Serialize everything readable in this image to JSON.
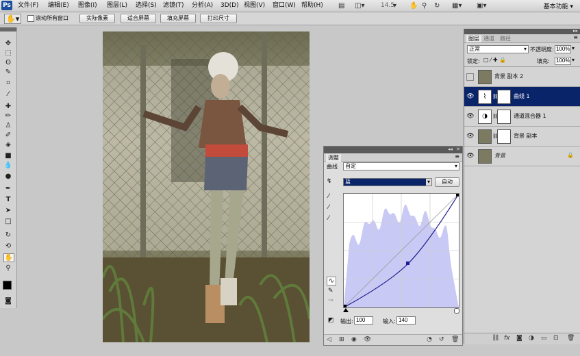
{
  "menu": {
    "logo": "Ps",
    "items": [
      "文件(F)",
      "编辑(E)",
      "图像(I)",
      "图层(L)",
      "选择(S)",
      "滤镜(T)",
      "分析(A)",
      "3D(D)",
      "视图(V)",
      "窗口(W)",
      "帮助(H)"
    ],
    "zoom": "14.5",
    "workspace": "基本功能"
  },
  "options": {
    "scroll_all_label": "滚动所有窗口",
    "buttons": [
      "实际像素",
      "适合屏幕",
      "填充屏幕",
      "打印尺寸"
    ]
  },
  "adjustments": {
    "tab": "调整",
    "preset_label": "曲线",
    "preset_value": "自定",
    "channel": "蓝",
    "auto_label": "自动",
    "output_label": "输出:",
    "output_value": "100",
    "input_label": "输入:",
    "input_value": "140"
  },
  "layers": {
    "tabs": [
      "图层",
      "通道",
      "路径"
    ],
    "blend_mode": "正常",
    "opacity_label": "不透明度:",
    "opacity_value": "100%",
    "lock_label": "锁定:",
    "fill_label": "填充:",
    "fill_value": "100%",
    "rows": [
      {
        "name": "背景 副本 2",
        "visible": false,
        "selected": false
      },
      {
        "name": "曲线 1",
        "visible": true,
        "selected": true
      },
      {
        "name": "通道混合器 1",
        "visible": true,
        "selected": false
      },
      {
        "name": "背景 副本",
        "visible": true,
        "selected": false
      },
      {
        "name": "背景",
        "visible": true,
        "selected": false
      }
    ]
  },
  "colors": {
    "selection": "#0a246a",
    "histogram": "#c9c9f5",
    "curve": "#1b1b8c"
  }
}
